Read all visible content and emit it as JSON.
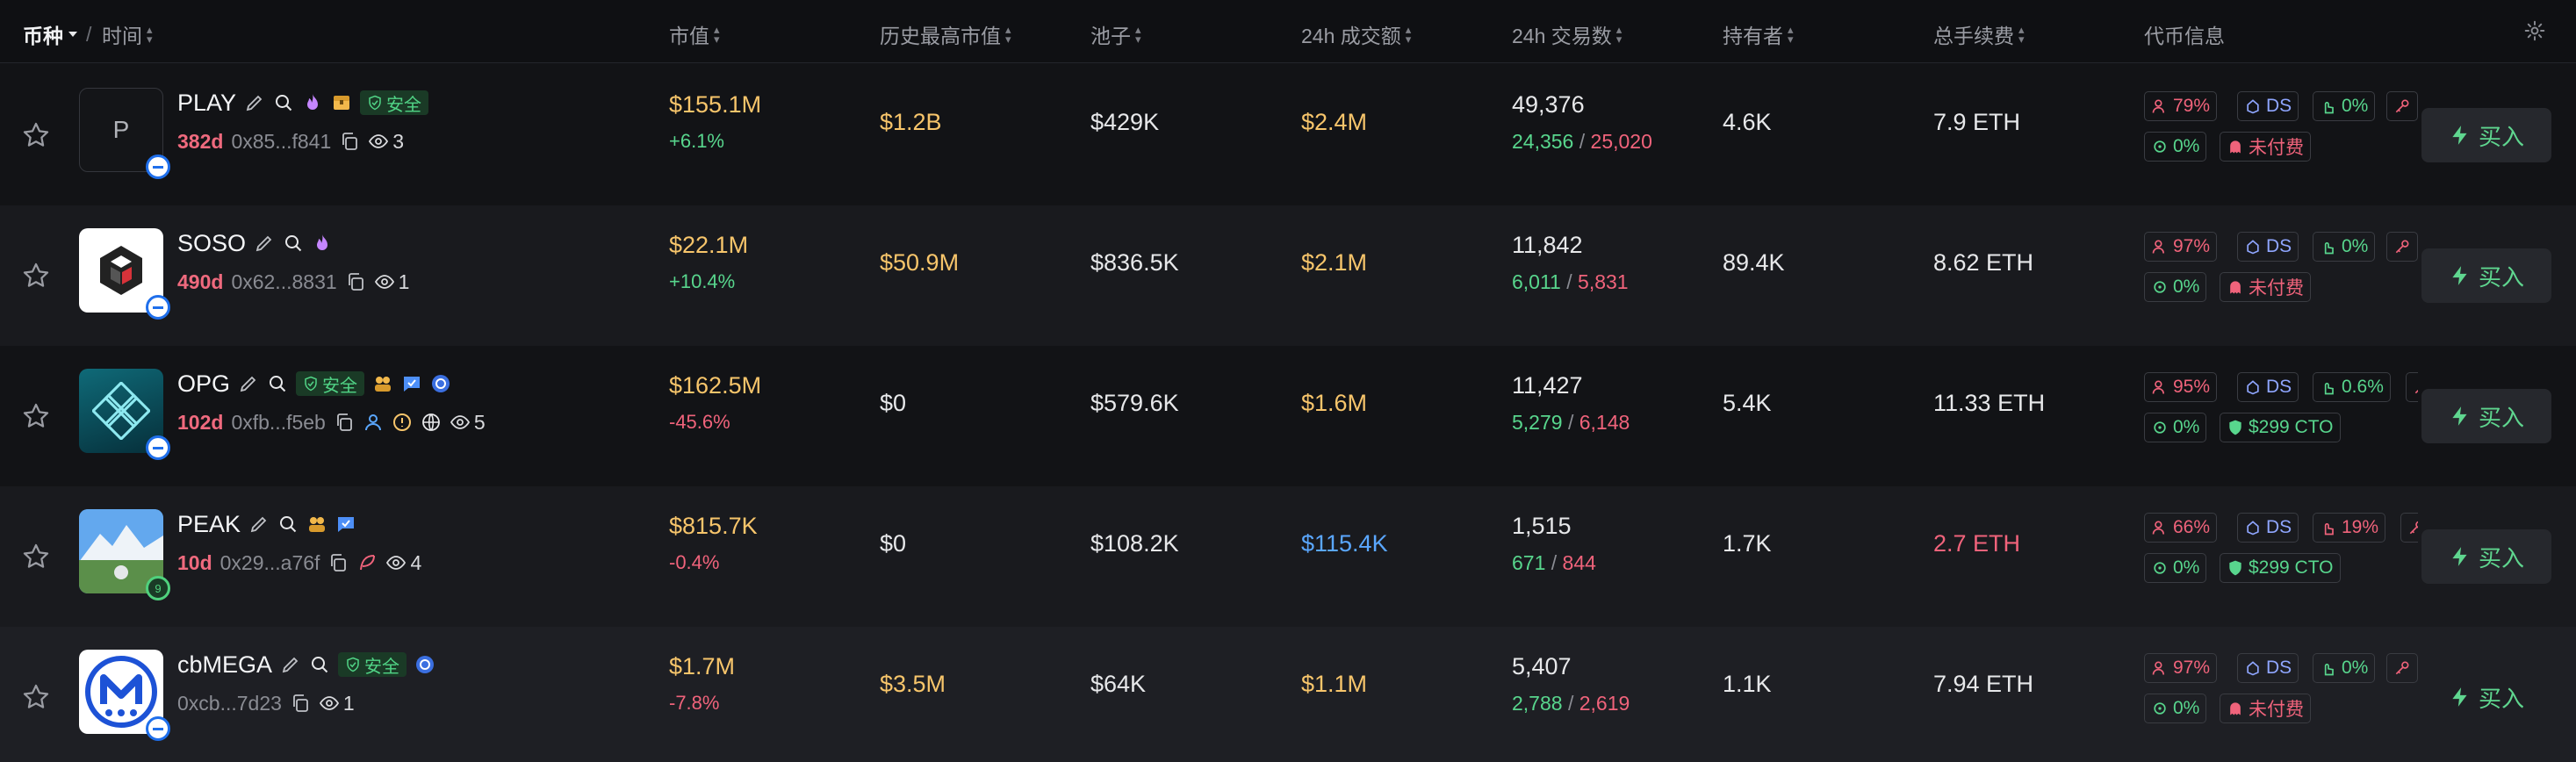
{
  "header": {
    "coin": "币种",
    "sep": "/",
    "time": "时间",
    "market_cap": "市值",
    "ath_cap": "历史最高市值",
    "pool": "池子",
    "volume": "24h 成交额",
    "txns": "24h 交易数",
    "holders": "持有者",
    "fees": "总手续费",
    "token_info": "代币信息"
  },
  "buy_label": "买入",
  "safe_label": "安全",
  "slash": "/",
  "rows": [
    {
      "name": "PLAY",
      "logo_text": "P",
      "age": "382d",
      "address": "0x85...f841",
      "views": "3",
      "market_cap": "$155.1M",
      "change": "+6.1%",
      "ath": "$1.2B",
      "pool": "$429K",
      "volume": "$2.4M",
      "txns": "49,376",
      "buys": "24,356",
      "sells": "25,020",
      "holders": "4.6K",
      "fees": "7.9 ETH",
      "chips": {
        "top": "79%",
        "ds": "DS",
        "dev": "0%",
        "snipe": "0%",
        "paid": "未付费"
      }
    },
    {
      "name": "SOSO",
      "age": "490d",
      "address": "0x62...8831",
      "views": "1",
      "market_cap": "$22.1M",
      "change": "+10.4%",
      "ath": "$50.9M",
      "pool": "$836.5K",
      "volume": "$2.1M",
      "txns": "11,842",
      "buys": "6,011",
      "sells": "5,831",
      "holders": "89.4K",
      "fees": "8.62 ETH",
      "chips": {
        "top": "97%",
        "ds": "DS",
        "dev": "0%",
        "snipe": "0%",
        "paid": "未付费"
      }
    },
    {
      "name": "OPG",
      "age": "102d",
      "address": "0xfb...f5eb",
      "views": "5",
      "market_cap": "$162.5M",
      "change": "-45.6%",
      "ath": "$0",
      "pool": "$579.6K",
      "volume": "$1.6M",
      "txns": "11,427",
      "buys": "5,279",
      "sells": "6,148",
      "holders": "5.4K",
      "fees": "11.33 ETH",
      "chips": {
        "top": "95%",
        "ds": "DS",
        "dev": "0.6%",
        "snipe": "0%",
        "paid": "$299 CTO"
      }
    },
    {
      "name": "PEAK",
      "age": "10d",
      "address": "0x29...a76f",
      "views": "4",
      "badge": "9",
      "market_cap": "$815.7K",
      "change": "-0.4%",
      "ath": "$0",
      "pool": "$108.2K",
      "volume": "$115.4K",
      "txns": "1,515",
      "buys": "671",
      "sells": "844",
      "holders": "1.7K",
      "fees": "2.7 ETH",
      "chips": {
        "top": "66%",
        "ds": "DS",
        "dev": "19%",
        "snipe": "0%",
        "paid": "$299 CTO"
      }
    },
    {
      "name": "cbMEGA",
      "age": "",
      "address": "0xcb...7d23",
      "views": "1",
      "market_cap": "$1.7M",
      "change": "-7.8%",
      "ath": "$3.5M",
      "pool": "$64K",
      "volume": "$1.1M",
      "txns": "5,407",
      "buys": "2,788",
      "sells": "2,619",
      "holders": "1.1K",
      "fees": "7.94 ETH",
      "chips": {
        "top": "97%",
        "ds": "DS",
        "dev": "0%",
        "snipe": "0%",
        "paid": "未付费"
      }
    }
  ]
}
